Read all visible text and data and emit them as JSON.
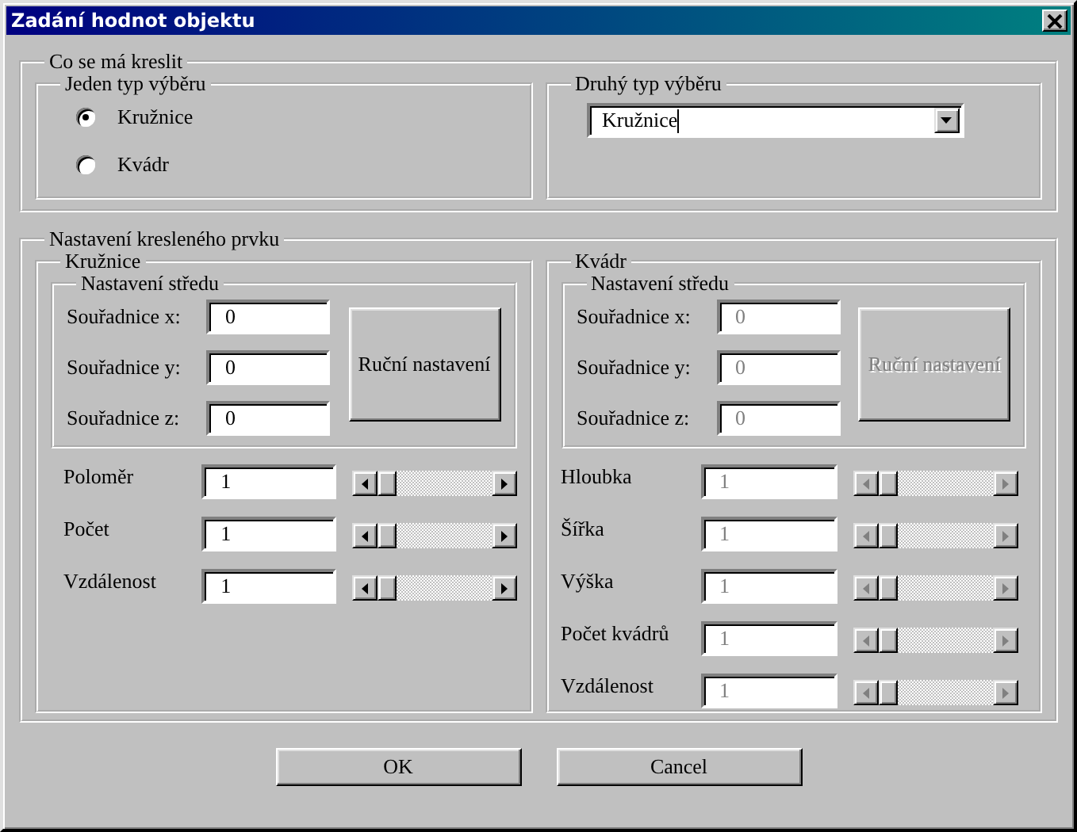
{
  "window": {
    "title": "Zadání hodnot objektu"
  },
  "what_to_draw": {
    "title": "Co se má kreslit",
    "single": {
      "title": "Jeden typ výběru",
      "options": [
        {
          "label": "Kružnice",
          "selected": true
        },
        {
          "label": "Kvádr",
          "selected": false
        }
      ]
    },
    "second": {
      "title": "Druhý typ výběru",
      "value": "Kružnice"
    }
  },
  "settings": {
    "title": "Nastavení kresleného prvku",
    "panels": [
      {
        "title": "Kružnice",
        "disabled": false,
        "center": {
          "title": "Nastavení středu",
          "fields": [
            {
              "label": "Souřadnice x:",
              "value": "0"
            },
            {
              "label": "Souřadnice y:",
              "value": "0"
            },
            {
              "label": "Souřadnice z:",
              "value": "0"
            }
          ],
          "button": "Ruční nastavení"
        },
        "params": [
          {
            "label": "Poloměr",
            "value": "1",
            "level": 0
          },
          {
            "label": "Počet",
            "value": "1",
            "level": 0
          },
          {
            "label": "Vzdálenost",
            "value": "1",
            "level": 0
          }
        ]
      },
      {
        "title": "Kvádr",
        "disabled": true,
        "center": {
          "title": "Nastavení středu",
          "fields": [
            {
              "label": "Souřadnice x:",
              "value": "0"
            },
            {
              "label": "Souřadnice y:",
              "value": "0"
            },
            {
              "label": "Souřadnice z:",
              "value": "0"
            }
          ],
          "button": "Ruční nastavení"
        },
        "params": [
          {
            "label": "Hloubka",
            "value": "1",
            "level": 0
          },
          {
            "label": "Šířka",
            "value": "1",
            "level": 0
          },
          {
            "label": "Výška",
            "value": "1",
            "level": 0
          },
          {
            "label": "Počet kvádrů",
            "value": "1",
            "level": 0
          },
          {
            "label": "Vzdálenost",
            "value": "1",
            "level": 0
          }
        ]
      }
    ]
  },
  "buttons": [
    "OK",
    "Cancel"
  ]
}
